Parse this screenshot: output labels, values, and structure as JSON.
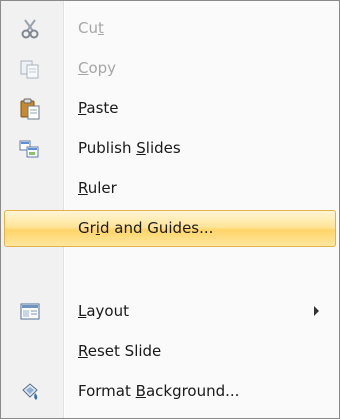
{
  "menu": {
    "items": [
      {
        "pre": "Cu",
        "key": "t",
        "post": "",
        "icon": "scissors-icon",
        "disabled": true
      },
      {
        "pre": "",
        "key": "C",
        "post": "opy",
        "icon": "copy-icon",
        "disabled": true
      },
      {
        "pre": "",
        "key": "P",
        "post": "aste",
        "icon": "paste-icon",
        "disabled": false
      },
      {
        "pre": "Publish ",
        "key": "S",
        "post": "lides",
        "icon": "publish-slides-icon",
        "disabled": false
      },
      {
        "pre": "",
        "key": "R",
        "post": "uler",
        "icon": "",
        "disabled": false
      },
      {
        "pre": "Gr",
        "key": "i",
        "post": "d and Guides...",
        "icon": "",
        "disabled": false,
        "highlighted": true
      },
      {
        "pre": "",
        "key": "L",
        "post": "ayout",
        "icon": "layout-icon",
        "disabled": false,
        "submenu": true
      },
      {
        "pre": "",
        "key": "R",
        "post": "eset Slide",
        "icon": "",
        "disabled": false
      },
      {
        "pre": "Format ",
        "key": "B",
        "post": "ackground...",
        "icon": "format-background-icon",
        "disabled": false
      }
    ]
  },
  "colors": {
    "highlight_top": "#fff6d6",
    "highlight_bottom": "#ffd56a",
    "highlight_border": "#e3b24a",
    "disabled_text": "#a6a6a6"
  }
}
